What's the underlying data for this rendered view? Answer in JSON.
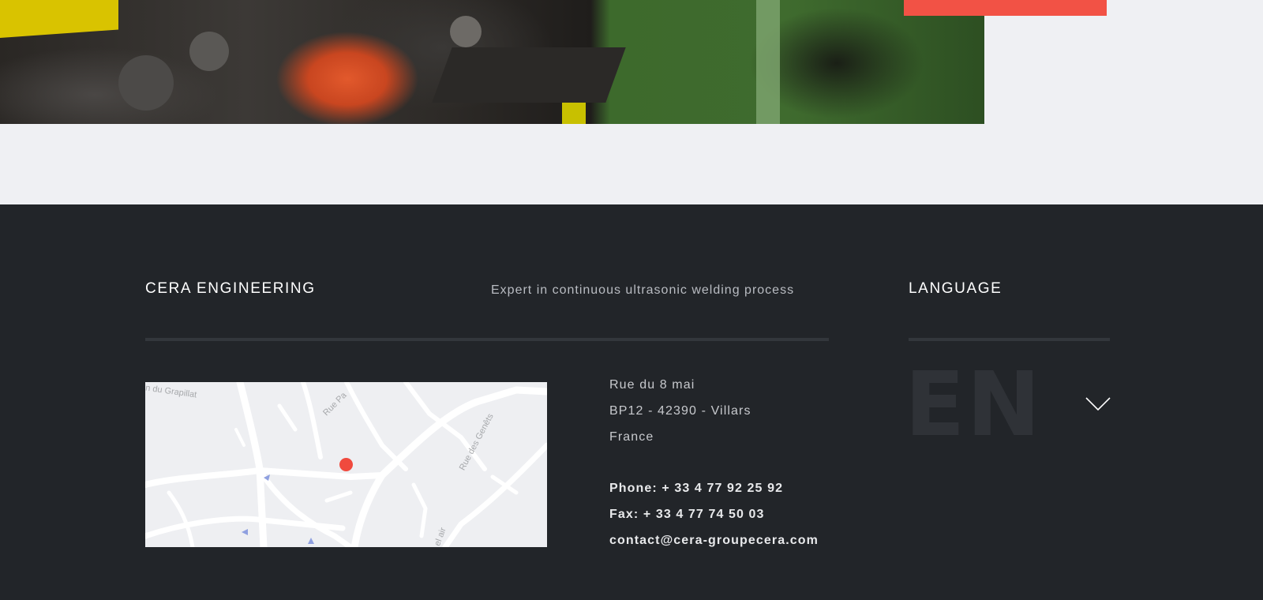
{
  "hero": {
    "image": "industrial-machine-photo",
    "accent_color": "#f25245"
  },
  "footer": {
    "brand": "CERA ENGINEERING",
    "tagline": "Expert in continuous ultrasonic welding process",
    "language_heading": "LANGUAGE",
    "background": "#222529",
    "map": {
      "streets": [
        "n du Grapillat",
        "Rue Pa",
        "Rue des Genêts",
        "el air"
      ],
      "pin_color": "#f04a3e"
    },
    "address": {
      "line1": "Rue du 8 mai",
      "line2": "BP12 - 42390 - Villars",
      "line3": "France",
      "phone_label": "Phone: ",
      "phone": "+ 33 4 77 92 25 92",
      "fax_label": "Fax: ",
      "fax": "+ 33 4 77 74 50 03",
      "email": "contact@cera-groupecera.com"
    },
    "language": {
      "selected": "EN",
      "icon": "chevron-down-icon"
    }
  }
}
